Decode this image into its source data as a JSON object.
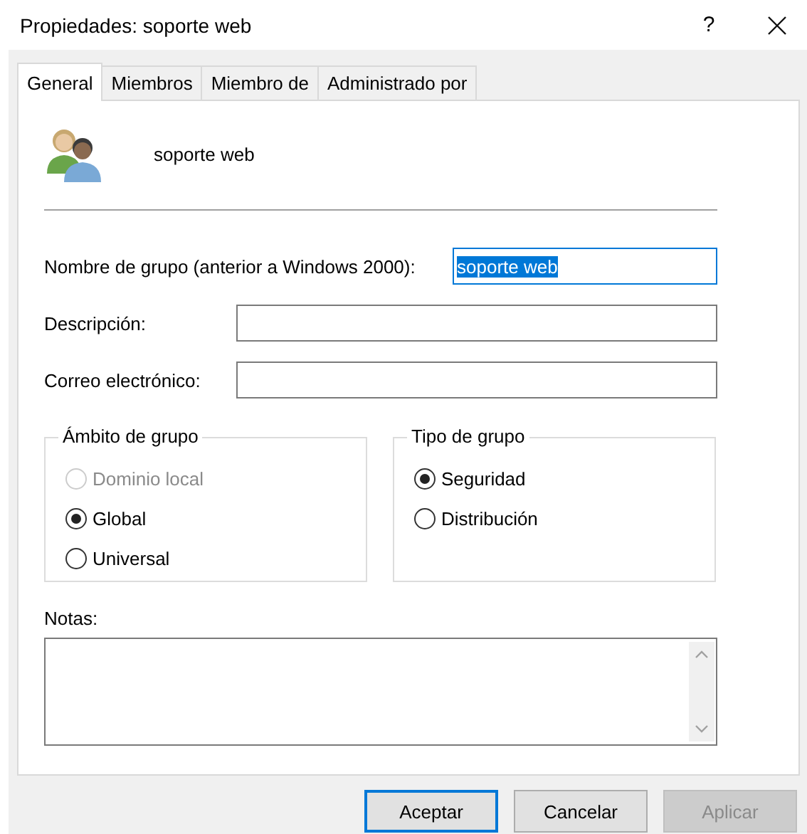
{
  "window": {
    "title": "Propiedades: soporte web",
    "help": "?"
  },
  "tabs": [
    {
      "label": "General",
      "selected": true
    },
    {
      "label": "Miembros",
      "selected": false
    },
    {
      "label": "Miembro de",
      "selected": false
    },
    {
      "label": "Administrado por",
      "selected": false
    }
  ],
  "group_name": "soporte web",
  "fields": [
    {
      "label": "Nombre de grupo (anterior a Windows 2000):",
      "value": "soporte web",
      "text_selected": true,
      "kind": "short"
    },
    {
      "label": "Descripción:",
      "kind": "long"
    },
    {
      "label": "Correo electrónico:",
      "kind": "long"
    }
  ],
  "group_scope": {
    "title": "Ámbito de grupo",
    "options": [
      {
        "label": "Dominio local",
        "selected": false,
        "disabled": true
      },
      {
        "label": "Global",
        "selected": true,
        "disabled": false
      },
      {
        "label": "Universal",
        "selected": false,
        "disabled": false
      }
    ]
  },
  "group_type": {
    "title": "Tipo de grupo",
    "options": [
      {
        "label": "Seguridad",
        "selected": true,
        "disabled": false
      },
      {
        "label": "Distribución",
        "selected": false,
        "disabled": false
      }
    ]
  },
  "notes": {
    "label": "Notas:"
  },
  "buttons": [
    {
      "label": "Aceptar",
      "default": true,
      "disabled": false
    },
    {
      "label": "Cancelar",
      "default": false,
      "disabled": false
    },
    {
      "label": "Aplicar",
      "default": false,
      "disabled": true
    }
  ]
}
